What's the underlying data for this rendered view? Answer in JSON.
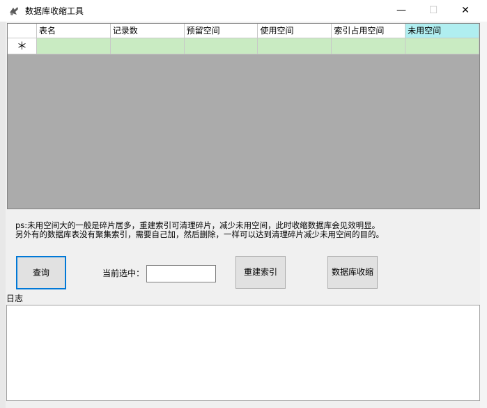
{
  "window": {
    "title": "数据库收缩工具",
    "min_glyph": "—",
    "max_glyph": "☐",
    "close_glyph": "✕"
  },
  "grid": {
    "columns": [
      "表名",
      "记录数",
      "预留空间",
      "使用空间",
      "索引占用空间",
      "未用空间"
    ],
    "new_row_marker": "＊"
  },
  "note": {
    "line1": "ps:未用空间大的一般是碎片居多，重建索引可清理碎片，减少未用空间，此时收缩数据库会见效明显。",
    "line2": "另外有的数据库表没有聚集索引，需要自己加，然后删除，一样可以达到清理碎片减少未用空间的目的。"
  },
  "controls": {
    "query_label": "查询",
    "current_selection_label": "当前选中：",
    "current_selection_value": "",
    "rebuild_index_label": "重建索引",
    "shrink_db_label": "数据库收缩"
  },
  "log": {
    "label": "日志",
    "content": ""
  },
  "colors": {
    "grid_background": "#ababab",
    "new_row": "#c9ebc2",
    "active_header": "#b0eef0",
    "focus_border": "#0078d7"
  }
}
